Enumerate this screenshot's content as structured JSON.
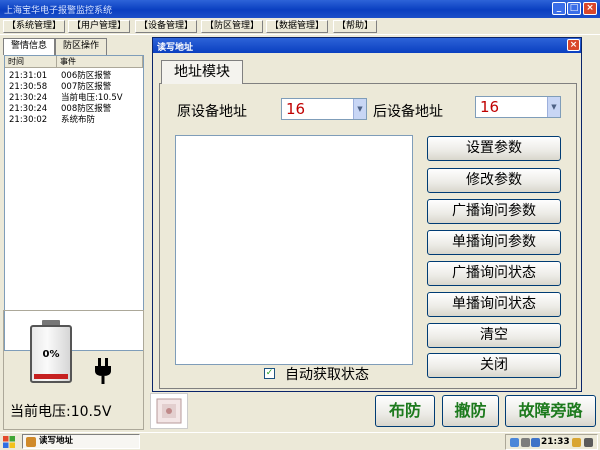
{
  "app": {
    "title": "上海宝华电子报警监控系统"
  },
  "menu": [
    "【系统管理】",
    "【用户管理】",
    "【设备管理】",
    "【防区管理】",
    "【数据管理】",
    "【帮助】"
  ],
  "left_panel": {
    "tabs": [
      "警情信息",
      "防区操作"
    ],
    "columns": [
      "时间",
      "事件"
    ],
    "events": [
      {
        "time": "21:31:01",
        "text": "006防区报警"
      },
      {
        "time": "21:30:58",
        "text": "007防区报警"
      },
      {
        "time": "21:30:24",
        "text": "当前电压:10.5V"
      },
      {
        "time": "21:30:24",
        "text": "008防区报警"
      },
      {
        "time": "21:30:02",
        "text": "系统布防"
      }
    ],
    "battery": {
      "percent_label": "0%",
      "level": 0.0
    },
    "voltage_label": "当前电压:10.5V"
  },
  "dialog": {
    "title": "读写地址",
    "close_glyph": "×",
    "tab_label": "地址模块",
    "orig_addr_label": "原设备地址",
    "orig_addr_value": "16",
    "new_addr_label": "后设备地址",
    "new_addr_value": "16",
    "buttons": [
      "设置参数",
      "修改参数",
      "广播询问参数",
      "单播询问参数",
      "广播询问状态",
      "单播询问状态",
      "清空",
      "关闭"
    ],
    "auto_status_label": "自动获取状态",
    "auto_status_checked": true
  },
  "bottom": {
    "arm": "布防",
    "disarm": "撤防",
    "bypass": "故障旁路"
  },
  "taskbar": {
    "task_label": "读写地址",
    "clock": "21:33"
  },
  "colors": {
    "accent_red": "#c00000",
    "action_green": "#1d7a1d",
    "titlebar_blue": "#0a3fc0"
  }
}
